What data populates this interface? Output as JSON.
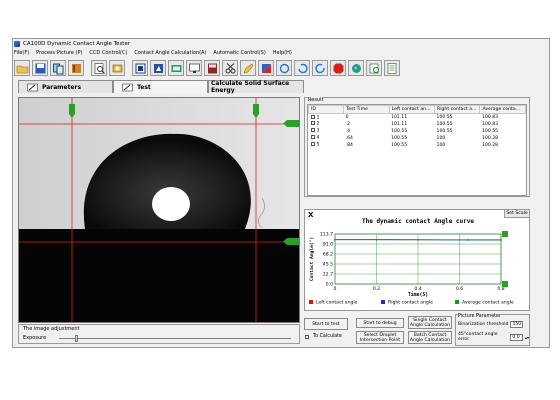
{
  "window": {
    "title": "CA100D Dynamic Contact Angle Tester"
  },
  "menu": [
    "File(F)",
    "Process Picture (P)",
    "CCD Control(C)",
    "Contact Angle Calculation(A)",
    "Automatic Control(S)",
    "Help(H)"
  ],
  "toolbar_icons": [
    "open-folder-icon",
    "save-icon",
    "copy-icon",
    "book-icon",
    "print-preview-icon",
    "settings-icon",
    "crop-icon",
    "camera-icon",
    "video-icon",
    "monitor-icon",
    "calculator-icon",
    "scissors-icon",
    "pencil-icon",
    "color-icon",
    "reset-icon",
    "rotate-icon",
    "refresh-icon",
    "stop-icon",
    "globe-icon",
    "zoom-icon",
    "document-icon"
  ],
  "tabs": {
    "parameters": "Parameters",
    "test": "Test",
    "calculate": "Calculate Solid Surface Energy"
  },
  "image_adjust": {
    "label": "The image adjustment",
    "exposure_label": "Exposure"
  },
  "result": {
    "label": "Result",
    "columns": [
      "ID",
      "Test Time",
      "Left contact an...",
      "Right contact a...",
      "Average conta..."
    ],
    "rows": [
      [
        "1",
        "0",
        "101.11",
        "100.55",
        "100.83"
      ],
      [
        "2",
        ".2",
        "101.11",
        "100.55",
        "100.83"
      ],
      [
        "3",
        ".4",
        "100.55",
        "100.55",
        "100.55"
      ],
      [
        "4",
        ".64",
        "100.55",
        "100",
        "100.28"
      ],
      [
        "5",
        ".84",
        "100.55",
        "100",
        "100.28"
      ]
    ]
  },
  "curve": {
    "x_icon_label": "X",
    "set_scale": "Set Scale",
    "legend": [
      "Left contact angle",
      "Right contact angle",
      "Average contact angle"
    ]
  },
  "chart_data": {
    "type": "line",
    "title": "The dynamic contact Angle curve",
    "xlabel": "Time(S)",
    "ylabel": "Contact Angle(°)",
    "x_ticks": [
      "0",
      "0.2",
      "0.4",
      "0.6",
      "0.8"
    ],
    "y_ticks": [
      "0.0",
      "22.7",
      "45.5",
      "68.2",
      "91.0",
      "113.7"
    ],
    "xlim": [
      0,
      0.8
    ],
    "ylim": [
      0,
      113.7
    ],
    "grid": true,
    "legend_position": "bottom",
    "series": [
      {
        "name": "Left contact angle",
        "color": "#e01010",
        "x": [
          0,
          0.2,
          0.4,
          0.64,
          0.84
        ],
        "values": [
          101.11,
          101.11,
          100.55,
          100.55,
          100.55
        ]
      },
      {
        "name": "Right contact angle",
        "color": "#1030d0",
        "x": [
          0,
          0.2,
          0.4,
          0.64,
          0.84
        ],
        "values": [
          100.55,
          100.55,
          100.55,
          100,
          100
        ]
      },
      {
        "name": "Average contact angle",
        "color": "#10a010",
        "x": [
          0,
          0.2,
          0.4,
          0.64,
          0.84
        ],
        "values": [
          100.83,
          100.83,
          100.55,
          100.28,
          100.28
        ]
      }
    ]
  },
  "buttons": {
    "start_test": "Start to test",
    "to_calculate": "To Calculate",
    "start_debug": "Start to debug",
    "select_droplet": "Select Droplet Intersection Point",
    "single_calc": "Single Contact Angle Calculation",
    "batch_calc": "Batch Contact Angle Calculation"
  },
  "picture_param": {
    "label": "Picture Parameter",
    "binarization_label": "Binarization threshold",
    "binarization_value": "150",
    "error_label": "45°contact angle error",
    "error_value": "0.0"
  }
}
